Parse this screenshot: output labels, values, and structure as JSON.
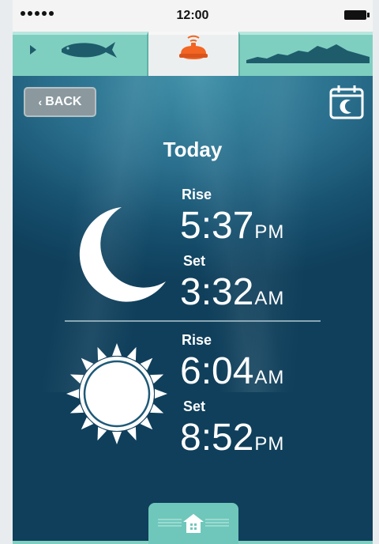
{
  "status_bar": {
    "time": "12:00"
  },
  "top_tabs": [
    {
      "name": "fish",
      "icon": "fish-icon"
    },
    {
      "name": "sonar",
      "icon": "sonar-icon",
      "active": true
    },
    {
      "name": "depth",
      "icon": "depth-profile-icon"
    }
  ],
  "back_button": {
    "label": "BACK"
  },
  "title": "Today",
  "moon": {
    "rise_label": "Rise",
    "rise_time": "5:37",
    "rise_suffix": "PM",
    "set_label": "Set",
    "set_time": "3:32",
    "set_suffix": "AM"
  },
  "sun": {
    "rise_label": "Rise",
    "rise_time": "6:04",
    "rise_suffix": "AM",
    "set_label": "Set",
    "set_time": "8:52",
    "set_suffix": "PM"
  },
  "colors": {
    "accent": "#7fcfc1",
    "sonar": "#f26522",
    "water_dark": "#0f3f5b",
    "water_light": "#3e8fa8"
  }
}
